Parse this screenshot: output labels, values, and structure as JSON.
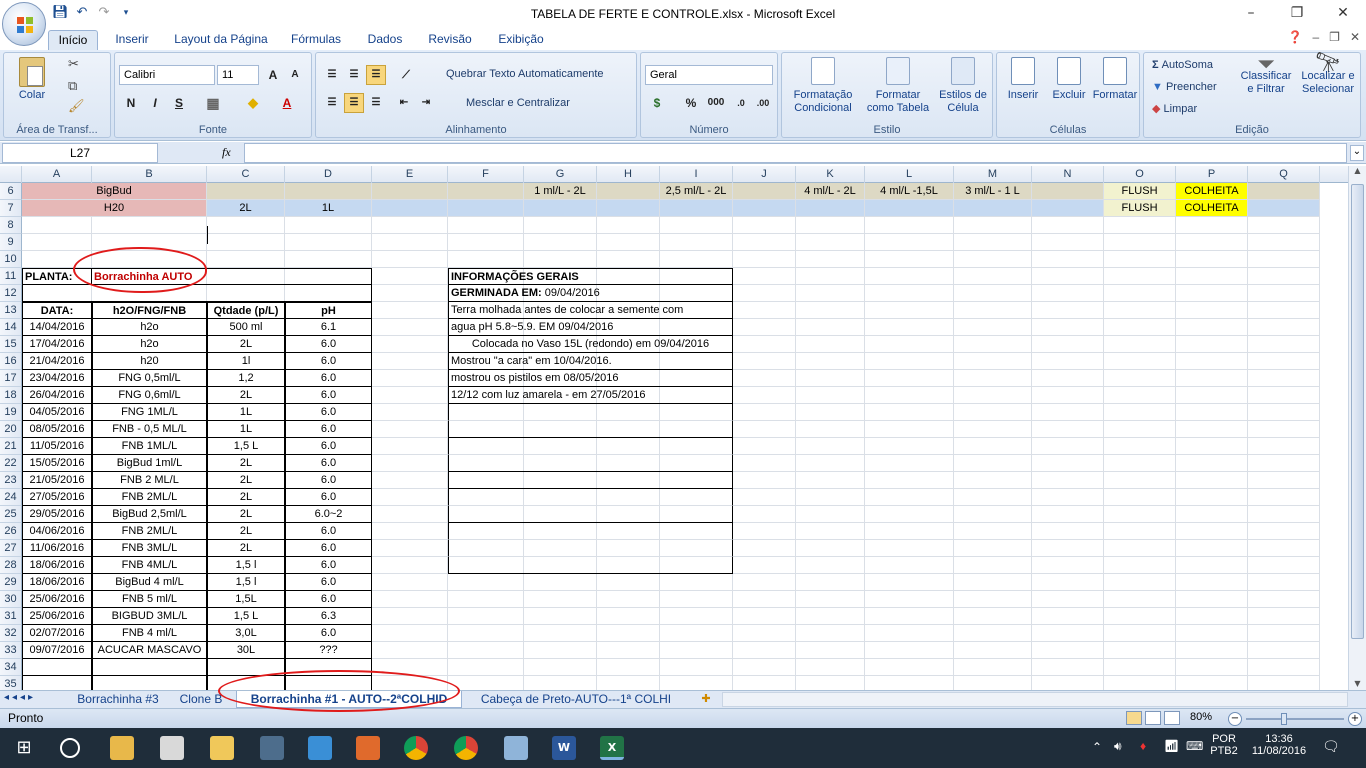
{
  "window": {
    "title": "TABELA DE FERTE E CONTROLE.xlsx - Microsoft Excel",
    "min": "–",
    "max": "❐",
    "close": "✕"
  },
  "tabs": [
    "Início",
    "Inserir",
    "Layout da Página",
    "Fórmulas",
    "Dados",
    "Revisão",
    "Exibição"
  ],
  "ribbon": {
    "clipboard": {
      "title": "Área de Transf...",
      "paste": "Colar"
    },
    "font": {
      "title": "Fonte",
      "name": "Calibri",
      "size": "11",
      "bold": "N",
      "italic": "I",
      "underline": "S",
      "grow": "A",
      "shrink": "A",
      "color": "A"
    },
    "alignment": {
      "title": "Alinhamento",
      "wrap": "Quebrar Texto Automaticamente",
      "merge": "Mesclar e Centralizar"
    },
    "number": {
      "title": "Número",
      "format": "Geral",
      "percent": "%",
      "thousands": "000"
    },
    "styles": {
      "title": "Estilo",
      "conditional": [
        "Formatação",
        "Condicional"
      ],
      "table": [
        "Formatar",
        "como Tabela"
      ],
      "cell": [
        "Estilos de",
        "Célula"
      ]
    },
    "cells": {
      "title": "Células",
      "insert": "Inserir",
      "delete": "Excluir",
      "format": "Formatar"
    },
    "editing": {
      "title": "Edição",
      "autosum": "AutoSoma",
      "fill": "Preencher",
      "clear": "Limpar",
      "sort": [
        "Classificar",
        "e Filtrar"
      ],
      "find": [
        "Localizar e",
        "Selecionar"
      ]
    }
  },
  "namebox": "L27",
  "fx": "fx",
  "columns": [
    "A",
    "B",
    "C",
    "D",
    "E",
    "F",
    "G",
    "H",
    "I",
    "J",
    "K",
    "L",
    "M",
    "N",
    "O",
    "P",
    "Q"
  ],
  "rows": {
    "r6": {
      "num": "6",
      "B": "BigBud",
      "G": "1 ml/L - 2L",
      "I": "2,5 ml/L - 2L",
      "K": "4 ml/L - 2L",
      "L": "4 ml/L -1,5L",
      "M": "3 ml/L - 1 L",
      "O": "FLUSH",
      "P": "COLHEITA"
    },
    "r7": {
      "num": "7",
      "B": "H20",
      "C": "2L",
      "D": "1L",
      "O": "FLUSH",
      "P": "COLHEITA"
    },
    "r11": {
      "label": "PLANTA:",
      "value": "Borrachinha AUTO"
    },
    "r13": {
      "h1": "DATA:",
      "h2": "h2O/FNG/FNB",
      "h3": "Qtdade (p/L)",
      "h4": "pH"
    }
  },
  "log": [
    [
      "14/04/2016",
      "h2o",
      "500 ml",
      "6.1"
    ],
    [
      "17/04/2016",
      "h2o",
      "2L",
      "6.0"
    ],
    [
      "21/04/2016",
      "h20",
      "1l",
      "6.0"
    ],
    [
      "23/04/2016",
      "FNG 0,5ml/L",
      "1,2",
      "6.0"
    ],
    [
      "26/04/2016",
      "FNG 0,6ml/L",
      "2L",
      "6.0"
    ],
    [
      "04/05/2016",
      "FNG 1ML/L",
      "1L",
      "6.0"
    ],
    [
      "08/05/2016",
      "FNB - 0,5 ML/L",
      "1L",
      "6.0"
    ],
    [
      "11/05/2016",
      "FNB 1ML/L",
      "1,5 L",
      "6.0"
    ],
    [
      "15/05/2016",
      "BigBud 1ml/L",
      "2L",
      "6.0"
    ],
    [
      "21/05/2016",
      "FNB 2 ML/L",
      "2L",
      "6.0"
    ],
    [
      "27/05/2016",
      "FNB 2ML/L",
      "2L",
      "6.0"
    ],
    [
      "29/05/2016",
      "BigBud 2,5ml/L",
      "2L",
      "6.0~2"
    ],
    [
      "04/06/2016",
      "FNB 2ML/L",
      "2L",
      "6.0"
    ],
    [
      "11/06/2016",
      "FNB 3ML/L",
      "2L",
      "6.0"
    ],
    [
      "18/06/2016",
      "FNB 4ML/L",
      "1,5 l",
      "6.0"
    ],
    [
      "18/06/2016",
      "BigBud 4 ml/L",
      "1,5 l",
      "6.0"
    ],
    [
      "25/06/2016",
      "FNB 5 ml/L",
      "1,5L",
      "6.0"
    ],
    [
      "25/06/2016",
      "BIGBUD 3ML/L",
      "1,5 L",
      "6.3"
    ],
    [
      "02/07/2016",
      "FNB 4 ml/L",
      "3,0L",
      "6.0"
    ],
    [
      "09/07/2016",
      "ACUCAR MASCAVO",
      "30L",
      "???"
    ]
  ],
  "info": {
    "title": "INFORMAÇÕES GERAIS",
    "germ_label": "GERMINADA EM:",
    "germ_date": "09/04/2016",
    "lines": [
      "Terra molhada antes de colocar a semente com",
      "agua pH 5.8~5.9. EM 09/04/2016",
      "Colocada no Vaso 15L (redondo) em 09/04/2016",
      "Mostrou \"a cara\" em 10/04/2016.",
      "mostrou os pistilos em 08/05/2016",
      "12/12 com luz amarela - em 27/05/2016"
    ]
  },
  "sheets": [
    "Borrachinha #3",
    "Clone B",
    "Borrachinha #1 - AUTO--2ªCOLHID",
    "Cabeça de Preto-AUTO---1ª COLHI"
  ],
  "status": {
    "ready": "Pronto",
    "zoom": "80%"
  },
  "tray": {
    "lang1": "POR",
    "lang2": "PTB2",
    "time": "13:36",
    "date": "11/08/2016"
  }
}
